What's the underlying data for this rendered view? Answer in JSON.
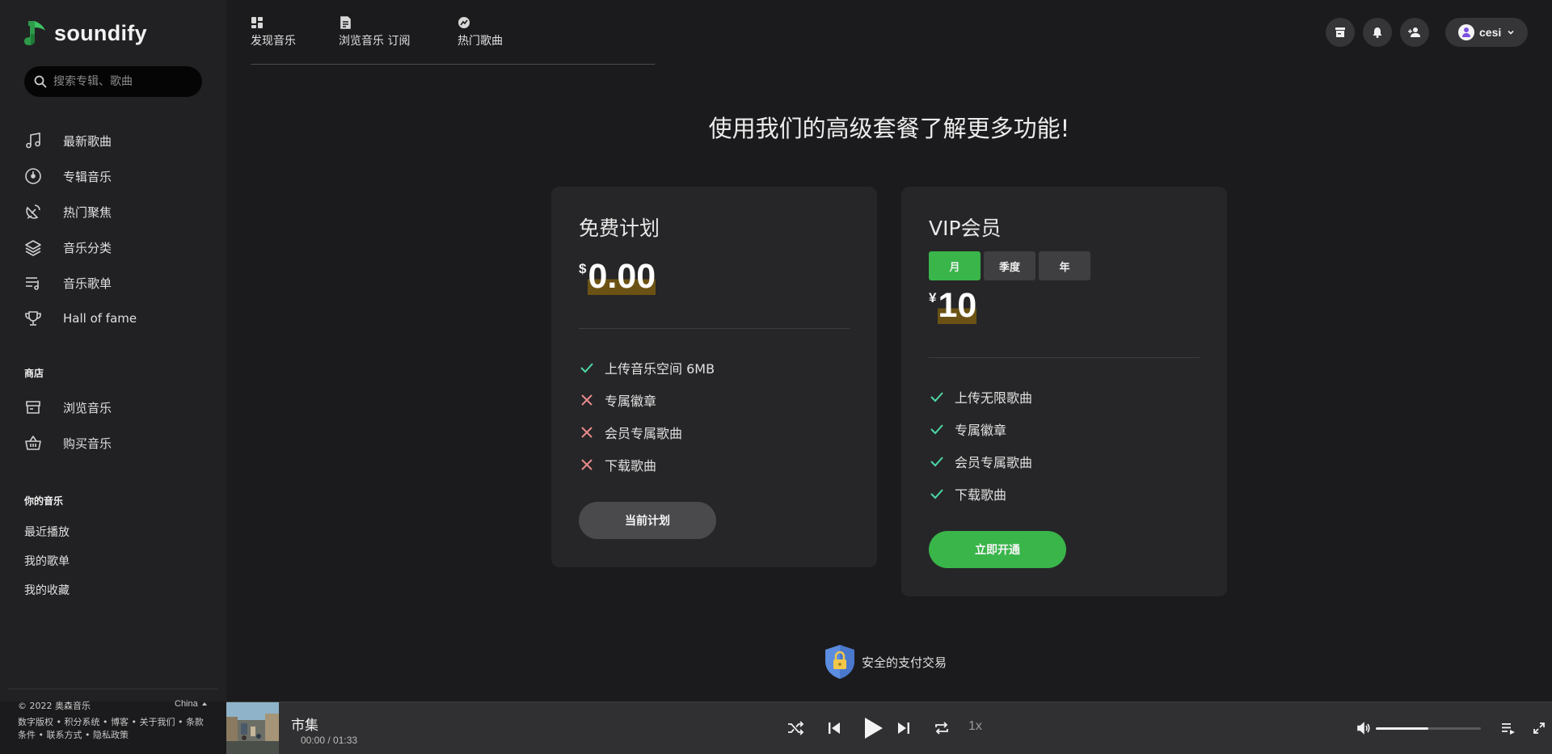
{
  "app": {
    "name": "soundify"
  },
  "search": {
    "placeholder": "搜索专辑、歌曲"
  },
  "sidebar": {
    "items": [
      {
        "label": "最新歌曲",
        "icon": "music-note-icon"
      },
      {
        "label": "专辑音乐",
        "icon": "album-disc-icon"
      },
      {
        "label": "热门聚焦",
        "icon": "satellite-dish-icon"
      },
      {
        "label": "音乐分类",
        "icon": "layers-icon"
      },
      {
        "label": "音乐歌单",
        "icon": "playlist-icon"
      },
      {
        "label": "Hall of fame",
        "icon": "trophy-icon"
      }
    ],
    "store_title": "商店",
    "store_items": [
      {
        "label": "浏览音乐",
        "icon": "store-icon"
      },
      {
        "label": "购买音乐",
        "icon": "basket-icon"
      }
    ],
    "your_music_title": "你的音乐",
    "your_music_items": [
      "最近播放",
      "我的歌单",
      "我的收藏"
    ],
    "footer": {
      "copyright": "© 2022 奥森音乐",
      "region": "China",
      "links": [
        "数字版权",
        "积分系统",
        "博客",
        "关于我们",
        "条款条件",
        "联系方式",
        "隐私政策"
      ],
      "separator": " • "
    }
  },
  "topnav": {
    "tabs": [
      {
        "label": "发现音乐",
        "icon": "dashboard-icon"
      },
      {
        "label": "浏览音乐 订阅",
        "icon": "document-icon"
      },
      {
        "label": "热门歌曲",
        "icon": "trending-icon"
      }
    ]
  },
  "header": {
    "icons": [
      "store-icon",
      "bell-icon",
      "add-user-icon"
    ],
    "user": {
      "name": "cesi"
    }
  },
  "page": {
    "heading": "使用我们的高级套餐了解更多功能!"
  },
  "plans": {
    "free": {
      "title": "免费计划",
      "currency": "$",
      "price": "0.00",
      "features": [
        {
          "label": "上传音乐空间 6MB",
          "included": true
        },
        {
          "label": "专属徽章",
          "included": false
        },
        {
          "label": "会员专属歌曲",
          "included": false
        },
        {
          "label": "下载歌曲",
          "included": false
        }
      ],
      "button": "当前计划"
    },
    "vip": {
      "title": "VIP会员",
      "periods": [
        "月",
        "季度",
        "年"
      ],
      "selected_period": "月",
      "currency": "¥",
      "price": "10",
      "features": [
        {
          "label": "上传无限歌曲",
          "included": true
        },
        {
          "label": "专属徽章",
          "included": true
        },
        {
          "label": "会员专属歌曲",
          "included": true
        },
        {
          "label": "下载歌曲",
          "included": true
        }
      ],
      "button": "立即开通"
    }
  },
  "secure": {
    "label": "安全的支付交易"
  },
  "player": {
    "title": "市集",
    "current_time": "00:00",
    "separator": " / ",
    "duration": "01:33",
    "speed": "1x",
    "volume": 0.5
  },
  "colors": {
    "accent": "#39b54a",
    "check": "#4cd9a4",
    "cross": "#e88a8a",
    "price_highlight": "#6b5214"
  }
}
